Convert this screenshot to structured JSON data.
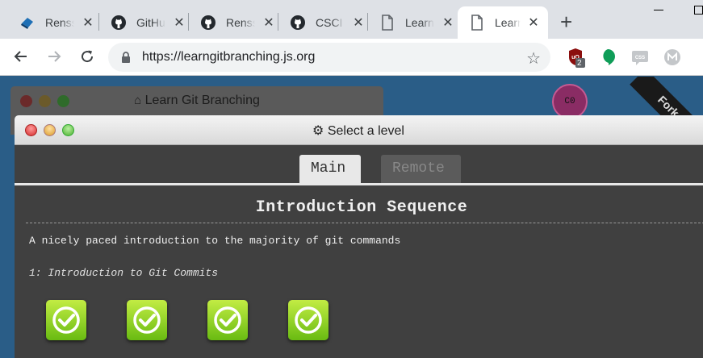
{
  "browser": {
    "tabs": [
      {
        "title": "Rensselaer",
        "icon": "rpi-logo-icon"
      },
      {
        "title": "GitHub",
        "icon": "github-icon"
      },
      {
        "title": "Rensselaer",
        "icon": "github-icon"
      },
      {
        "title": "CSCI",
        "icon": "github-icon"
      },
      {
        "title": "Learn",
        "icon": "page-icon"
      },
      {
        "title": "Learn",
        "icon": "page-icon",
        "active": true
      }
    ],
    "url": "https://learngitbranching.js.org",
    "extension_badge": "2"
  },
  "page": {
    "bg_window_title": "Learn Git Branching",
    "commit_label": "C0",
    "ribbon_text": "Fork"
  },
  "modal": {
    "title": "Select a level",
    "tabs": {
      "main": "Main",
      "remote": "Remote"
    },
    "sequence_title": "Introduction Sequence",
    "sequence_about": "A nicely paced introduction to the majority of git commands",
    "level_name": "1: Introduction to Git Commits",
    "levels_completed": 4
  },
  "colors": {
    "page_bg": "#2a5d87",
    "modal_bg": "#404040",
    "level_done_top": "#c2ec44",
    "level_done_bottom": "#69bb12",
    "commit": "#8a2c64"
  }
}
